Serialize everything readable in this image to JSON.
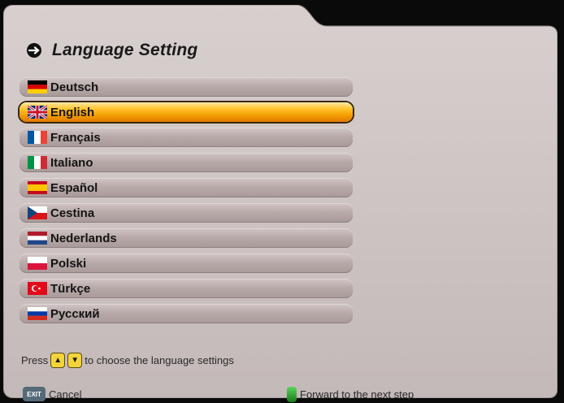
{
  "title": "Language Setting",
  "icons": {
    "title": "arrow-circle-icon",
    "up": "up-arrow-icon",
    "down": "down-arrow-icon",
    "exit": "exit-key-icon",
    "next": "green-key-icon"
  },
  "languages": [
    {
      "label": "Deutsch",
      "flag": "de"
    },
    {
      "label": "English",
      "flag": "gb",
      "selected": true
    },
    {
      "label": "Français",
      "flag": "fr"
    },
    {
      "label": "Italiano",
      "flag": "it"
    },
    {
      "label": "Español",
      "flag": "es"
    },
    {
      "label": "Cestina",
      "flag": "cz"
    },
    {
      "label": "Nederlands",
      "flag": "nl"
    },
    {
      "label": "Polski",
      "flag": "pl"
    },
    {
      "label": "Türkçe",
      "flag": "tr"
    },
    {
      "label": "Русский",
      "flag": "ru"
    }
  ],
  "help": {
    "prefix": "Press",
    "up_key": "▲",
    "down_key": "▼",
    "suffix": "to choose the language settings"
  },
  "footer": {
    "exit_key": "EXIT",
    "cancel_label": "Cancel",
    "next_label": "Forward to the next step"
  },
  "colors": {
    "panel": "#c8bebe",
    "selection": "#ffb600",
    "accent_green": "#3aa83a"
  }
}
